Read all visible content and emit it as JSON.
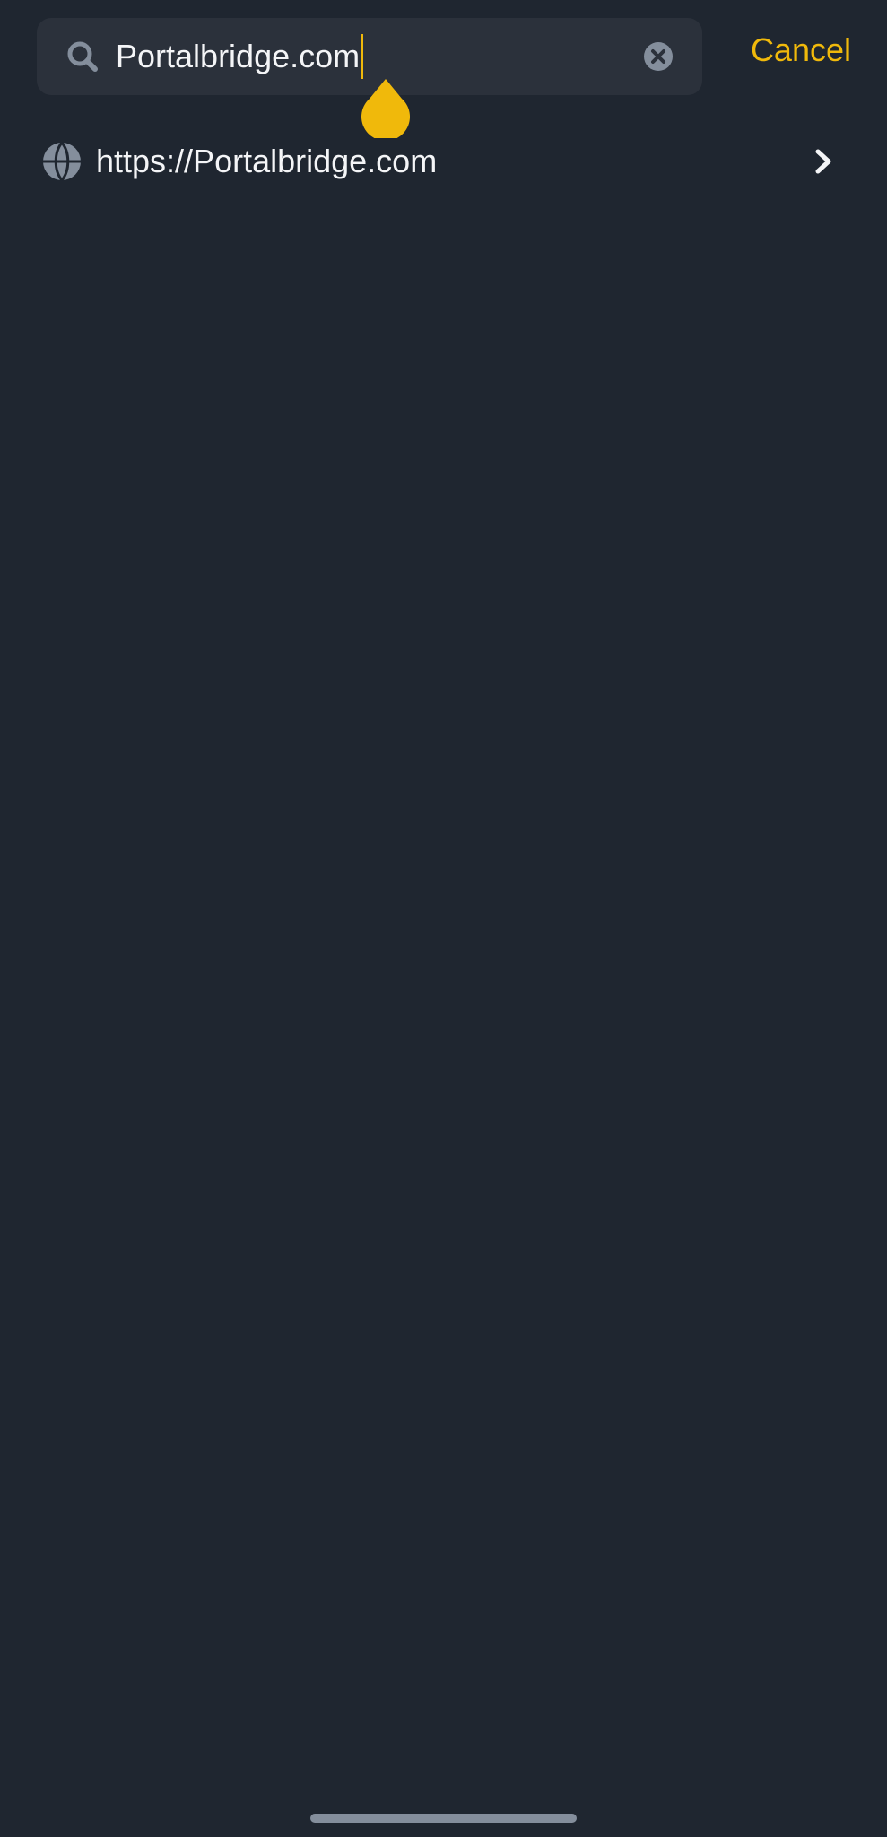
{
  "search": {
    "value": "Portalbridge.com",
    "cancel_label": "Cancel"
  },
  "results": [
    {
      "label": "https://Portalbridge.com",
      "icon": "globe-icon"
    }
  ],
  "colors": {
    "background": "#1f2630",
    "search_bg": "#2b313b",
    "accent": "#f0b90b",
    "icon_gray": "#848e9c",
    "text": "#f4f5f7"
  }
}
